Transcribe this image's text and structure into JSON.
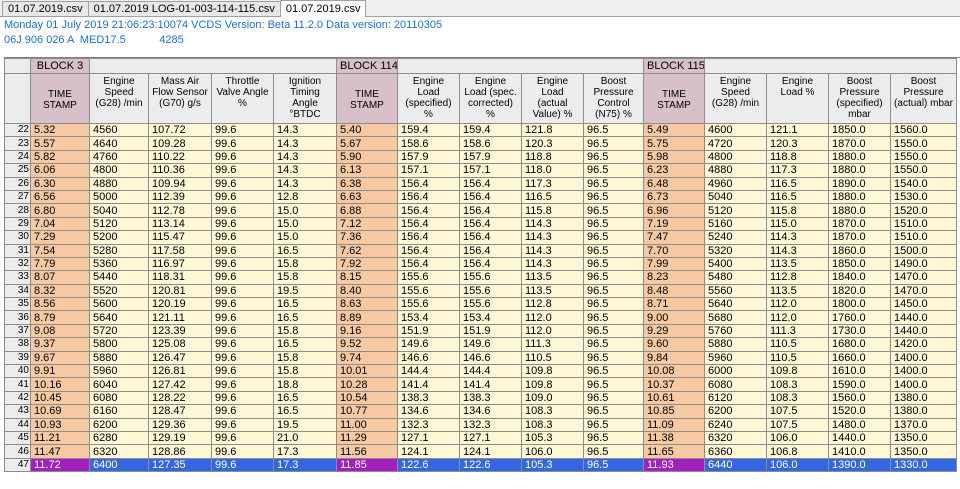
{
  "tabs": [
    {
      "label": "01.07.2019.csv",
      "active": false
    },
    {
      "label": "01.07.2019 LOG-01-003-114-115.csv",
      "active": false
    },
    {
      "label": "01.07.2019.csv",
      "active": true
    }
  ],
  "info": {
    "line1": "Monday 01 July 2019 21:06:23:10074 VCDS Version: Beta 11.2.0 Data version: 20110305",
    "line2": "06J 906 026 A  MED17.5           4285"
  },
  "blocks": {
    "b3": "BLOCK 3",
    "b114": "BLOCK 114",
    "b115": "BLOCK 115"
  },
  "headers": [
    "TIME STAMP",
    "Engine Speed (G28) /min",
    "Mass Air Flow Sensor (G70) g/s",
    "Throttle Valve Angle %",
    "Ignition Timing Angle °BTDC",
    "TIME STAMP",
    "Engine Load (specified) %",
    "Engine Load (spec. corrected) %",
    "Engine Load (actual Value) %",
    "Boost Pressure Control (N75) %",
    "TIME STAMP",
    "Engine Speed (G28) /min",
    "Engine Load %",
    "Boost Pressure (specified) mbar",
    "Boost Pressure (actual) mbar"
  ],
  "rows": [
    {
      "n": "22",
      "c": [
        "5.32",
        "4560",
        "107.72",
        "99.6",
        "14.3",
        "5.40",
        "159.4",
        "159.4",
        "121.8",
        "96.5",
        "5.49",
        "4600",
        "121.1",
        "1850.0",
        "1560.0"
      ]
    },
    {
      "n": "23",
      "c": [
        "5.57",
        "4640",
        "109.28",
        "99.6",
        "14.3",
        "5.67",
        "158.6",
        "158.6",
        "120.3",
        "96.5",
        "5.75",
        "4720",
        "120.3",
        "1870.0",
        "1550.0"
      ]
    },
    {
      "n": "24",
      "c": [
        "5.82",
        "4760",
        "110.22",
        "99.6",
        "14.3",
        "5.90",
        "157.9",
        "157.9",
        "118.8",
        "96.5",
        "5.98",
        "4800",
        "118.8",
        "1880.0",
        "1550.0"
      ]
    },
    {
      "n": "25",
      "c": [
        "6.06",
        "4800",
        "110.36",
        "99.6",
        "14.3",
        "6.13",
        "157.1",
        "157.1",
        "118.0",
        "96.5",
        "6.23",
        "4880",
        "117.3",
        "1880.0",
        "1550.0"
      ]
    },
    {
      "n": "26",
      "c": [
        "6.30",
        "4880",
        "109.94",
        "99.6",
        "14.3",
        "6.38",
        "156.4",
        "156.4",
        "117.3",
        "96.5",
        "6.48",
        "4960",
        "116.5",
        "1890.0",
        "1540.0"
      ]
    },
    {
      "n": "27",
      "c": [
        "6.56",
        "5000",
        "112.39",
        "99.6",
        "12.8",
        "6.63",
        "156.4",
        "156.4",
        "116.5",
        "96.5",
        "6.73",
        "5040",
        "116.5",
        "1880.0",
        "1530.0"
      ]
    },
    {
      "n": "28",
      "c": [
        "6.80",
        "5040",
        "112.78",
        "99.6",
        "15.0",
        "6.88",
        "156.4",
        "156.4",
        "115.8",
        "96.5",
        "6.96",
        "5120",
        "115.8",
        "1880.0",
        "1520.0"
      ]
    },
    {
      "n": "29",
      "c": [
        "7.04",
        "5120",
        "113.14",
        "99.6",
        "15.0",
        "7.12",
        "156.4",
        "156.4",
        "114.3",
        "96.5",
        "7.19",
        "5160",
        "115.0",
        "1870.0",
        "1510.0"
      ]
    },
    {
      "n": "30",
      "c": [
        "7.29",
        "5200",
        "115.47",
        "99.6",
        "15.0",
        "7.36",
        "156.4",
        "156.4",
        "114.3",
        "96.5",
        "7.47",
        "5240",
        "114.3",
        "1870.0",
        "1510.0"
      ]
    },
    {
      "n": "31",
      "c": [
        "7.54",
        "5280",
        "117.58",
        "99.6",
        "16.5",
        "7.62",
        "156.4",
        "156.4",
        "114.3",
        "96.5",
        "7.70",
        "5320",
        "114.3",
        "1860.0",
        "1500.0"
      ]
    },
    {
      "n": "32",
      "c": [
        "7.79",
        "5360",
        "116.97",
        "99.6",
        "15.8",
        "7.92",
        "156.4",
        "156.4",
        "114.3",
        "96.5",
        "7.99",
        "5400",
        "113.5",
        "1850.0",
        "1490.0"
      ]
    },
    {
      "n": "33",
      "c": [
        "8.07",
        "5440",
        "118.31",
        "99.6",
        "15.8",
        "8.15",
        "155.6",
        "155.6",
        "113.5",
        "96.5",
        "8.23",
        "5480",
        "112.8",
        "1840.0",
        "1470.0"
      ]
    },
    {
      "n": "34",
      "c": [
        "8.32",
        "5520",
        "120.81",
        "99.6",
        "19.5",
        "8.40",
        "155.6",
        "155.6",
        "113.5",
        "96.5",
        "8.48",
        "5560",
        "113.5",
        "1820.0",
        "1470.0"
      ]
    },
    {
      "n": "35",
      "c": [
        "8.56",
        "5600",
        "120.19",
        "99.6",
        "16.5",
        "8.63",
        "155.6",
        "155.6",
        "112.8",
        "96.5",
        "8.71",
        "5640",
        "112.0",
        "1800.0",
        "1450.0"
      ]
    },
    {
      "n": "36",
      "c": [
        "8.79",
        "5640",
        "121.11",
        "99.6",
        "16.5",
        "8.89",
        "153.4",
        "153.4",
        "112.0",
        "96.5",
        "9.00",
        "5680",
        "112.0",
        "1760.0",
        "1440.0"
      ]
    },
    {
      "n": "37",
      "c": [
        "9.08",
        "5720",
        "123.39",
        "99.6",
        "15.8",
        "9.16",
        "151.9",
        "151.9",
        "112.0",
        "96.5",
        "9.29",
        "5760",
        "111.3",
        "1730.0",
        "1440.0"
      ]
    },
    {
      "n": "38",
      "c": [
        "9.37",
        "5800",
        "125.08",
        "99.6",
        "16.5",
        "9.52",
        "149.6",
        "149.6",
        "111.3",
        "96.5",
        "9.60",
        "5880",
        "110.5",
        "1680.0",
        "1420.0"
      ]
    },
    {
      "n": "39",
      "c": [
        "9.67",
        "5880",
        "126.47",
        "99.6",
        "15.8",
        "9.74",
        "146.6",
        "146.6",
        "110.5",
        "96.5",
        "9.84",
        "5960",
        "110.5",
        "1660.0",
        "1400.0"
      ]
    },
    {
      "n": "40",
      "c": [
        "9.91",
        "5960",
        "126.81",
        "99.6",
        "15.8",
        "10.01",
        "144.4",
        "144.4",
        "109.8",
        "96.5",
        "10.08",
        "6000",
        "109.8",
        "1610.0",
        "1400.0"
      ]
    },
    {
      "n": "41",
      "c": [
        "10.16",
        "6040",
        "127.42",
        "99.6",
        "18.8",
        "10.28",
        "141.4",
        "141.4",
        "109.8",
        "96.5",
        "10.37",
        "6080",
        "108.3",
        "1590.0",
        "1400.0"
      ]
    },
    {
      "n": "42",
      "c": [
        "10.45",
        "6080",
        "128.22",
        "99.6",
        "16.5",
        "10.54",
        "138.3",
        "138.3",
        "109.0",
        "96.5",
        "10.61",
        "6120",
        "108.3",
        "1560.0",
        "1380.0"
      ]
    },
    {
      "n": "43",
      "c": [
        "10.69",
        "6160",
        "128.47",
        "99.6",
        "16.5",
        "10.77",
        "134.6",
        "134.6",
        "108.3",
        "96.5",
        "10.85",
        "6200",
        "107.5",
        "1520.0",
        "1380.0"
      ]
    },
    {
      "n": "44",
      "c": [
        "10.93",
        "6200",
        "129.36",
        "99.6",
        "19.5",
        "11.00",
        "132.3",
        "132.3",
        "108.3",
        "96.5",
        "11.09",
        "6240",
        "107.5",
        "1480.0",
        "1370.0"
      ]
    },
    {
      "n": "45",
      "c": [
        "11.21",
        "6280",
        "129.19",
        "99.6",
        "21.0",
        "11.29",
        "127.1",
        "127.1",
        "105.3",
        "96.5",
        "11.38",
        "6320",
        "106.0",
        "1440.0",
        "1350.0"
      ]
    },
    {
      "n": "46",
      "c": [
        "11.47",
        "6320",
        "128.86",
        "99.6",
        "17.3",
        "11.56",
        "124.1",
        "124.1",
        "106.0",
        "96.5",
        "11.65",
        "6360",
        "106.8",
        "1410.0",
        "1350.0"
      ]
    },
    {
      "n": "47",
      "c": [
        "11.72",
        "6400",
        "127.35",
        "99.6",
        "17.3",
        "11.85",
        "122.6",
        "122.6",
        "105.3",
        "96.5",
        "11.93",
        "6440",
        "106.0",
        "1390.0",
        "1330.0"
      ]
    }
  ],
  "selected_row": "47",
  "colors": {
    "timestamp_col": "#f7c9a3",
    "data_cell": "#fff7d6",
    "header": "#ececec",
    "block_header": "#d8c0c8",
    "selection": "#3366e0",
    "selection_ts": "#a020c0",
    "info_text": "#1f6fd0"
  }
}
